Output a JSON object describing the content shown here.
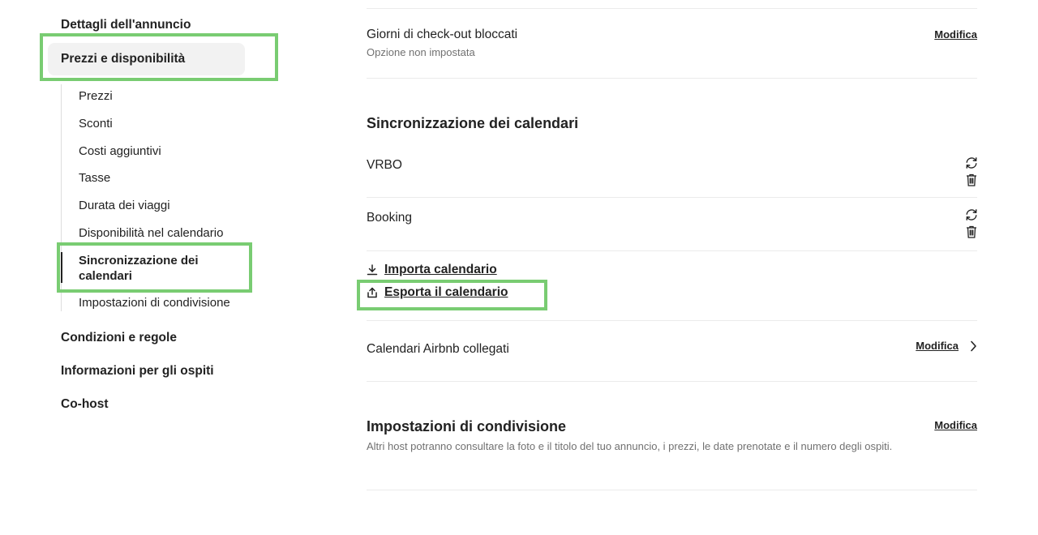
{
  "sidebar": {
    "top_item": "Dettagli dell'annuncio",
    "section": "Prezzi e disponibilità",
    "subitems": [
      "Prezzi",
      "Sconti",
      "Costi aggiuntivi",
      "Tasse",
      "Durata dei viaggi",
      "Disponibilità nel calendario",
      "Sincronizzazione dei calendari",
      "Impostazioni di condivisione"
    ],
    "bottom_items": [
      "Condizioni e regole",
      "Informazioni per gli ospiti",
      "Co-host"
    ]
  },
  "main": {
    "checkout": {
      "title": "Giorni di check-out bloccati",
      "subtitle": "Opzione non impostata",
      "edit": "Modifica"
    },
    "sync": {
      "heading": "Sincronizzazione dei calendari",
      "calendars": [
        "VRBO",
        "Booking"
      ],
      "import_label": "Importa calendario",
      "export_label": "Esporta il calendario"
    },
    "linked": {
      "title": "Calendari Airbnb collegati",
      "edit": "Modifica"
    },
    "sharing": {
      "heading": "Impostazioni di condivisione",
      "description": "Altri host potranno consultare la foto e il titolo del tuo annuncio, i prezzi, le date prenotate e il numero degli ospiti.",
      "edit": "Modifica"
    }
  },
  "icons": {
    "sync": "sync-icon",
    "delete": "trash-icon",
    "import": "download-icon",
    "export": "upload-icon",
    "chevron": "chevron-right-icon"
  },
  "colors": {
    "highlight": "#79cc72",
    "text": "#222222",
    "muted": "#717171"
  }
}
